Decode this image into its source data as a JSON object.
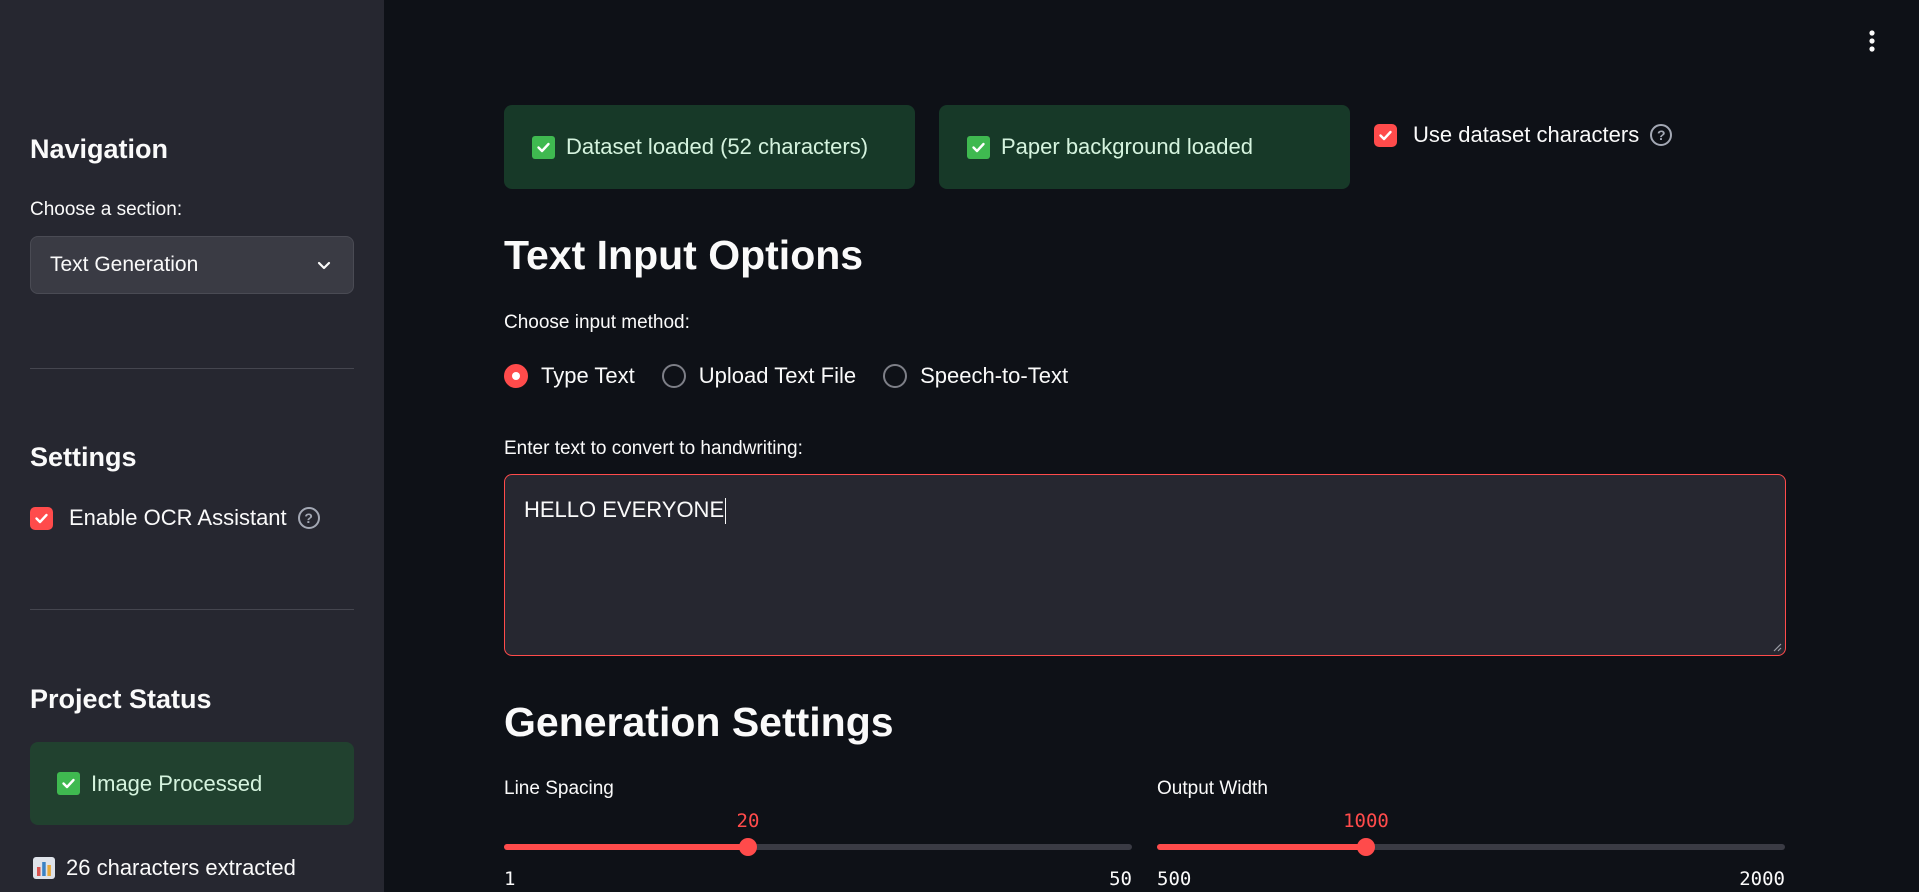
{
  "sidebar": {
    "nav_heading": "Navigation",
    "section_label": "Choose a section:",
    "section_selected": "Text Generation",
    "settings_heading": "Settings",
    "ocr_checkbox_label": "Enable OCR Assistant",
    "ocr_checked": true,
    "status_heading": "Project Status",
    "status_message": "Image Processed",
    "chars_extracted": "26 characters extracted"
  },
  "alerts": {
    "dataset": "Dataset loaded (52 characters)",
    "paper": "Paper background loaded",
    "use_dataset_label": "Use dataset characters",
    "use_dataset_checked": true
  },
  "text_input": {
    "heading": "Text Input Options",
    "method_label": "Choose input method:",
    "methods": [
      "Type Text",
      "Upload Text File",
      "Speech-to-Text"
    ],
    "selected_method": "Type Text",
    "textarea_label": "Enter text to convert to handwriting:",
    "textarea_value": "HELLO EVERYONE"
  },
  "generation": {
    "heading": "Generation Settings",
    "line_spacing": {
      "label": "Line Spacing",
      "value": "20",
      "min": "1",
      "max": "50"
    },
    "output_width": {
      "label": "Output Width",
      "value": "1000",
      "min": "500",
      "max": "2000"
    }
  },
  "colors": {
    "accent": "#ff4b4b",
    "success_bg": "#173928",
    "sidebar_bg": "#262730",
    "main_bg": "#0e1117"
  }
}
